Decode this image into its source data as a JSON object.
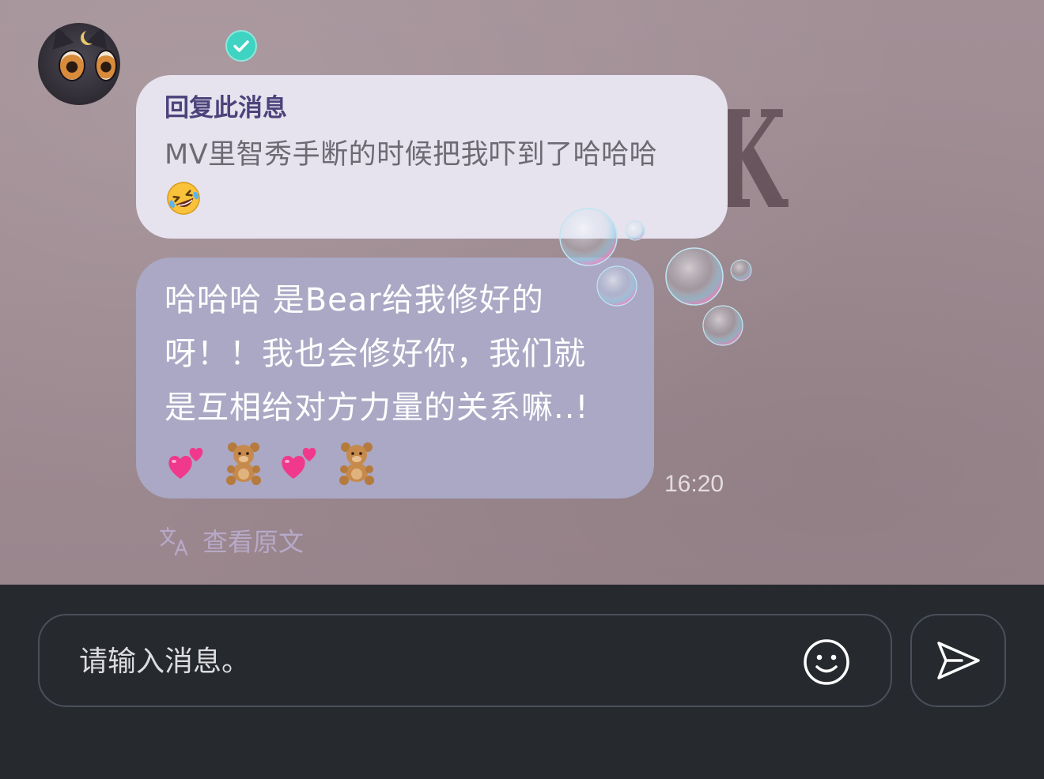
{
  "reply_quote": {
    "title": "回复此消息",
    "text": "MV里智秀手断的时候把我吓到了哈哈哈",
    "emoji_icon": "rolling-on-floor-laughing-emoji"
  },
  "message": {
    "lines": [
      "哈哈哈 是Bear给我修好的",
      "呀！！我也会修好你，我们就",
      "是互相给对方力量的关系嘛..!"
    ],
    "emoji_icons": [
      "two-hearts-emoji",
      "teddy-bear-emoji",
      "two-hearts-emoji",
      "teddy-bear-emoji"
    ],
    "time": "16:20"
  },
  "translate": {
    "label": "查看原文",
    "icon": "translate-icon"
  },
  "sender": {
    "avatar_icon": "black-cat-avatar",
    "badge_icon": "verified-check-icon"
  },
  "composer": {
    "placeholder": "请输入消息。",
    "emoji_button_icon": "smiley-icon",
    "send_button_icon": "send-icon"
  },
  "colors": {
    "chat_background": "#9d8990",
    "reply_bubble": "#e6e2ee",
    "reply_title": "#4b437a",
    "message_bubble": "#aaa8c4",
    "input_bar": "#26292e",
    "verified_badge": "#3fd3c2"
  }
}
